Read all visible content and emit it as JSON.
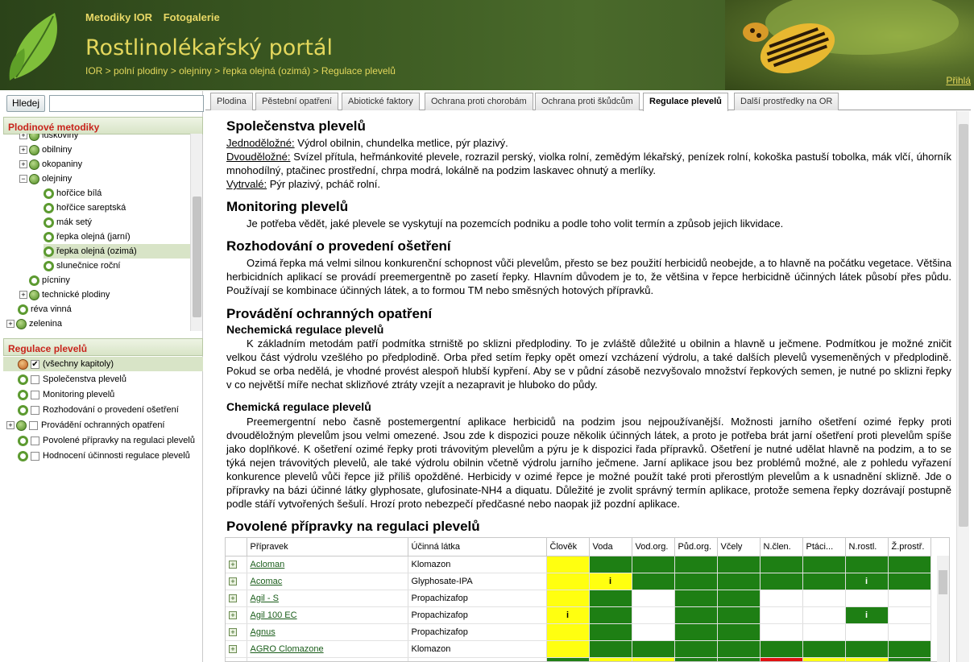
{
  "header": {
    "links": [
      "Metodiky IOR",
      "Fotogalerie"
    ],
    "title": "Rostlinolékařský portál",
    "breadcrumb": "IOR > polní plodiny > olejniny > řepka olejná (ozimá) > Regulace plevelů",
    "login": "Přihlá"
  },
  "search": {
    "button": "Hledej",
    "value": ""
  },
  "plant_panel": {
    "title": "Plodinové metodiky",
    "items": [
      {
        "label": "luskoviny",
        "expanded": false
      },
      {
        "label": "obilniny",
        "expanded": false
      },
      {
        "label": "okopaniny",
        "expanded": false
      },
      {
        "label": "olejniny",
        "expanded": true
      },
      {
        "label": "hořčice bílá"
      },
      {
        "label": "hořčice sareptská"
      },
      {
        "label": "mák setý"
      },
      {
        "label": "řepka olejná (jarní)"
      },
      {
        "label": "řepka olejná (ozimá)",
        "selected": true
      },
      {
        "label": "slunečnice roční"
      },
      {
        "label": "pícniny"
      },
      {
        "label": "technické plodiny",
        "expanded": false
      },
      {
        "label": "réva vinná"
      },
      {
        "label": "zelenina",
        "expanded": false
      }
    ]
  },
  "weed_panel": {
    "title": "Regulace plevelů",
    "items": [
      {
        "label": "(všechny kapitoly)",
        "checked": true
      },
      {
        "label": "Společenstva plevelů"
      },
      {
        "label": "Monitoring plevelů"
      },
      {
        "label": "Rozhodování o provedení ošetření"
      },
      {
        "label": "Provádění ochranných opatření"
      },
      {
        "label": "Povolené přípravky na regulaci plevelů"
      },
      {
        "label": "Hodnocení účinnosti regulace plevelů"
      }
    ]
  },
  "tabs": [
    "Plodina",
    "Pěstební opatření",
    "Abiotické faktory",
    "Ochrana proti chorobám",
    "Ochrana proti škůdcům",
    "Regulace plevelů",
    "Další prostředky na OR"
  ],
  "active_tab": "Regulace plevelů",
  "content": {
    "s1_title": "Společenstva plevelů",
    "s1_jedno_label": "Jednoděložné:",
    "s1_jedno": " Výdrol obilnin, chundelka metlice, pýr plazivý.",
    "s1_dvou_label": "Dvouděložné:",
    "s1_dvou": " Svízel přítula, heřmánkovité plevele, rozrazil perský, violka rolní, zemědým lékařský, penízek rolní, kokoška pastuší tobolka, mák vlčí, úhorník mnohodílný, ptačinec prostřední, chrpa modrá, lokálně na podzim laskavec ohnutý a merlíky.",
    "s1_vytr_label": "Vytrvalé:",
    "s1_vytr": " Pýr plazivý, pcháč rolní.",
    "s2_title": "Monitoring plevelů",
    "s2_text": "Je potřeba vědět, jaké plevele se vyskytují na pozemcích podniku a podle toho volit termín a způsob jejich likvidace.",
    "s3_title": "Rozhodování o provedení ošetření",
    "s3_text": "Ozimá řepka má velmi silnou konkurenční schopnost vůči plevelům, přesto se bez použití herbicidů neobejde, a to hlavně na počátku vegetace. Většina herbicidních aplikací se provádí preemergentně po zasetí řepky. Hlavním důvodem je to, že většina v řepce herbicidně účinných látek působí přes půdu. Používají se kombinace účinných látek, a to formou TM nebo směsných hotových přípravků.",
    "s4_title": "Provádění ochranných opatření",
    "s4a_title": "Nechemická regulace plevelů",
    "s4a_text": "K základním metodám patří podmítka strniště po sklizni předplodiny. To je zvláště důležité u obilnin a hlavně u ječmene. Podmítkou je možné zničit velkou část výdrolu vzešlého po předplodině. Orba před setím řepky opět omezí vzcházení výdrolu, a také dalších plevelů vysemeněných v předplodině. Pokud se orba nedělá, je vhodné provést alespoň hlubší kypření. Aby se v půdní zásobě nezvyšovalo množství řepkových semen, je nutné po sklizni řepky v co největší míře nechat sklizňové ztráty vzejít a nezapravit je hluboko do půdy.",
    "s4b_title": "Chemická regulace plevelů",
    "s4b_text": "Preemergentní nebo časně postemergentní aplikace herbicidů na podzim jsou nejpoužívanější. Možnosti jarního ošetření ozimé řepky proti dvouděložným plevelům jsou velmi omezené. Jsou zde k dispozici pouze několik účinných látek, a proto je potřeba brát jarní ošetření proti plevelům spíše jako doplňkové. K ošetření ozimé řepky proti trávovitým plevelům a pýru je k dispozici řada přípravků. Ošetření je nutné udělat hlavně na podzim, a to se týká nejen trávovitých plevelů, ale také výdrolu obilnin včetně výdrolu jarního ječmene. Jarní aplikace jsou bez problémů možné, ale z pohledu vyřazení konkurence plevelů vůči řepce již příliš opožděné. Herbicidy v ozimé řepce je možné použít také proti přerostlým plevelům a k usnadnění sklizně. Jde o přípravky na bázi účinné látky glyphosate, glufosinate-NH4 a diquatu. Důležité je zvolit správný termín aplikace, protože semena řepky dozrávají postupně podle stáří vytvořených šešulí. Hrozí proto nebezpečí předčasné nebo naopak již pozdní aplikace.",
    "s5_title": "Povolené přípravky na regulaci plevelů"
  },
  "grid": {
    "columns": [
      "Přípravek",
      "Účinná látka",
      "Člověk",
      "Voda",
      "Vod.org.",
      "Půd.org.",
      "Včely",
      "N.člen.",
      "Ptáci...",
      "N.rostl.",
      "Ž.prostř."
    ],
    "rows": [
      {
        "name": "Acloman",
        "substance": "Klomazon",
        "cells": [
          "y",
          "g",
          "g",
          "g",
          "g",
          "g",
          "g",
          "g",
          "g"
        ],
        "marks": [
          "",
          "",
          "",
          "",
          "",
          "",
          "",
          "",
          ""
        ]
      },
      {
        "name": "Acomac",
        "substance": "Glyphosate-IPA",
        "cells": [
          "y",
          "y",
          "g",
          "g",
          "g",
          "g",
          "g",
          "g",
          "g"
        ],
        "marks": [
          "",
          "i",
          "",
          "",
          "",
          "",
          "",
          "i",
          ""
        ]
      },
      {
        "name": "Agil - S",
        "substance": "Propachizafop",
        "cells": [
          "y",
          "g",
          "w",
          "g",
          "g",
          "w",
          "w",
          "w",
          "w"
        ],
        "marks": [
          "",
          "",
          "",
          "",
          "",
          "",
          "",
          "",
          ""
        ]
      },
      {
        "name": "Agil 100 EC",
        "substance": "Propachizafop",
        "cells": [
          "y",
          "g",
          "w",
          "g",
          "g",
          "w",
          "w",
          "g",
          "w"
        ],
        "marks": [
          "i",
          "",
          "",
          "",
          "",
          "",
          "",
          "i",
          ""
        ]
      },
      {
        "name": "Agnus",
        "substance": "Propachizafop",
        "cells": [
          "y",
          "g",
          "w",
          "g",
          "g",
          "w",
          "w",
          "w",
          "w"
        ],
        "marks": [
          "",
          "",
          "",
          "",
          "",
          "",
          "",
          "",
          ""
        ]
      },
      {
        "name": "AGRO Clomazone",
        "substance": "Klomazon",
        "cells": [
          "y",
          "g",
          "g",
          "g",
          "g",
          "g",
          "g",
          "g",
          "g"
        ],
        "marks": [
          "",
          "",
          "",
          "",
          "",
          "",
          "",
          "",
          ""
        ]
      },
      {
        "name": "",
        "substance": "",
        "cells": [
          "g",
          "y",
          "y",
          "g",
          "g",
          "r",
          "y",
          "y",
          "g"
        ],
        "marks": [
          "",
          "",
          "",
          "",
          "",
          "",
          "",
          "",
          ""
        ]
      }
    ]
  }
}
